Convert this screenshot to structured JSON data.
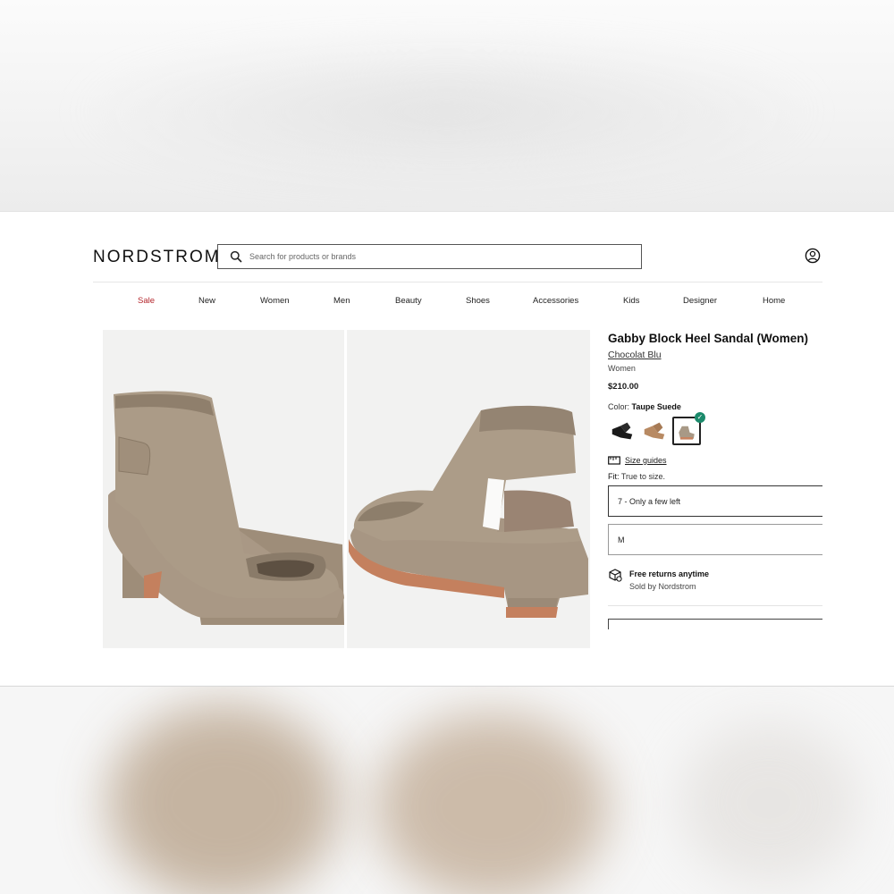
{
  "header": {
    "logo": "NORDSTROM",
    "search_placeholder": "Search for products or brands"
  },
  "nav": {
    "items": [
      "Sale",
      "New",
      "Women",
      "Men",
      "Beauty",
      "Shoes",
      "Accessories",
      "Kids",
      "Designer",
      "Home"
    ]
  },
  "product": {
    "title": "Gabby Block Heel Sandal (Women)",
    "brand": "Chocolat Blu",
    "department": "Women",
    "price": "$210.00",
    "color_label": "Color:",
    "color_value": "Taupe Suede",
    "swatches": [
      "black",
      "tan",
      "taupe"
    ],
    "selected_swatch": "taupe",
    "size_guide": "Size guides",
    "fit_label": "Fit:",
    "fit_value": "True to size.",
    "size_select": "7 - Only a few left",
    "width_select": "M",
    "returns_title": "Free returns anytime",
    "returns_sub": "Sold by Nordstrom"
  },
  "colors": {
    "sale": "#b4262c",
    "check": "#1b8a6b",
    "suede": "#a89986",
    "sole": "#c78360"
  }
}
